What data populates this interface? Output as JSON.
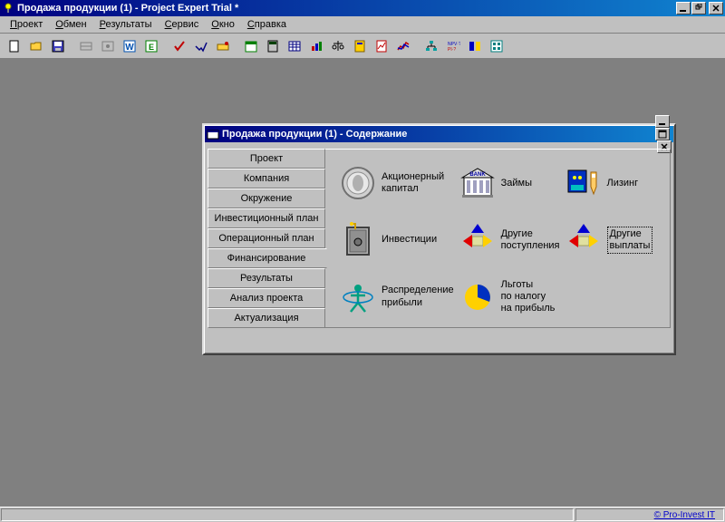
{
  "window": {
    "title": "Продажа продукции (1) - Project Expert Trial *"
  },
  "menu": {
    "items": [
      {
        "label": "Проект",
        "accel": "П"
      },
      {
        "label": "Обмен",
        "accel": "О"
      },
      {
        "label": "Результаты",
        "accel": "Р"
      },
      {
        "label": "Сервис",
        "accel": "С"
      },
      {
        "label": "Окно",
        "accel": "О"
      },
      {
        "label": "Справка",
        "accel": "С"
      }
    ]
  },
  "toolbar": {
    "groups": [
      [
        "new-icon",
        "open-icon",
        "save-icon"
      ],
      [
        "view1-icon",
        "view2-icon",
        "word-icon",
        "excel-icon"
      ],
      [
        "check-icon",
        "pass-icon",
        "trace-icon"
      ],
      [
        "calendar-icon",
        "calc-icon",
        "table-icon",
        "chart-icon",
        "balance-icon",
        "report1-icon",
        "report2-icon",
        "graph-icon"
      ],
      [
        "org-icon",
        "npv-icon",
        "cash-icon",
        "summary-icon"
      ]
    ]
  },
  "inner_window": {
    "title": "Продажа продукции (1) - Содержание",
    "tabs": [
      {
        "label": "Проект"
      },
      {
        "label": "Компания"
      },
      {
        "label": "Окружение"
      },
      {
        "label": "Инвестиционный план"
      },
      {
        "label": "Операционный план"
      },
      {
        "label": "Финансирование",
        "active": true
      },
      {
        "label": "Результаты"
      },
      {
        "label": "Анализ проекта"
      },
      {
        "label": "Актуализация"
      }
    ],
    "modules": [
      {
        "name": "share-capital",
        "icon": "coin-icon",
        "label": "Акционерный\nкапитал"
      },
      {
        "name": "loans",
        "icon": "bank-icon",
        "label": "Займы"
      },
      {
        "name": "leasing",
        "icon": "leasing-icon",
        "label": "Лизинг"
      },
      {
        "name": "investments",
        "icon": "safe-icon",
        "label": "Инвестиции"
      },
      {
        "name": "other-income",
        "icon": "arrows-icon",
        "label": "Другие\nпоступления"
      },
      {
        "name": "other-payments",
        "icon": "arrows2-icon",
        "label": "Другие\nвыплаты",
        "selected": true
      },
      {
        "name": "profit-dist",
        "icon": "atlas-icon",
        "label": "Распределение\nприбыли"
      },
      {
        "name": "tax-benefits",
        "icon": "pie-icon",
        "label": "Льготы\nпо налогу\nна прибыль"
      }
    ]
  },
  "statusbar": {
    "link": "© Pro-Invest IT"
  }
}
